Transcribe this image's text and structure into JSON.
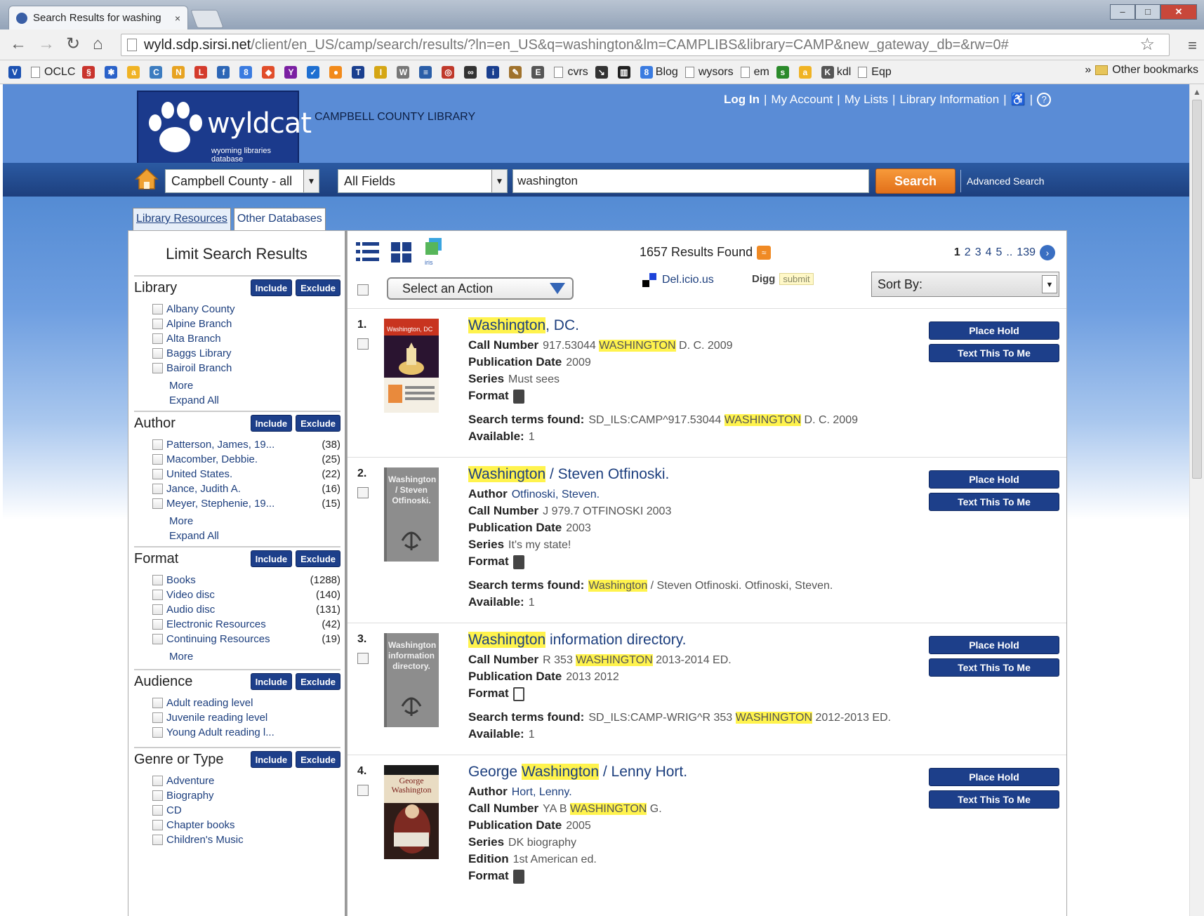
{
  "browser": {
    "tab_title": "Search Results for washing",
    "tab_close": "×",
    "url_host": "wyld.sdp.sirsi.net",
    "url_path": "/client/en_US/camp/search/results/?ln=en_US&q=washington&lm=CAMPLIBS&library=CAMP&new_gateway_db=&rw=0#",
    "window_min": "–",
    "window_max": "□",
    "window_close": "✕",
    "bookmarks": [
      {
        "label": "",
        "icon": "v-icon",
        "color": "#1c52b2",
        "glyph": "V"
      },
      {
        "label": "OCLC",
        "icon": "page-icon"
      },
      {
        "label": "",
        "icon": "swirl-icon",
        "color": "#c9342d",
        "glyph": "§"
      },
      {
        "label": "",
        "icon": "paw-icon",
        "color": "#2a62c9",
        "glyph": "✱"
      },
      {
        "label": "",
        "icon": "amazon-icon",
        "color": "#f0b324",
        "glyph": "a"
      },
      {
        "label": "",
        "icon": "cbd-icon",
        "color": "#3c7cc0",
        "glyph": "C"
      },
      {
        "label": "",
        "icon": "n-icon",
        "color": "#e7a321",
        "glyph": "N"
      },
      {
        "label": "",
        "icon": "lo-icon",
        "color": "#d43b2c",
        "glyph": "L"
      },
      {
        "label": "",
        "icon": "ff-icon",
        "color": "#2c66b6",
        "glyph": "f"
      },
      {
        "label": "",
        "icon": "8-icon",
        "color": "#3a7be0",
        "glyph": "8"
      },
      {
        "label": "",
        "icon": "cube-icon",
        "color": "#e14d2a",
        "glyph": "◆"
      },
      {
        "label": "",
        "icon": "yahoo-icon",
        "color": "#7a1fa2",
        "glyph": "Y"
      },
      {
        "label": "",
        "icon": "check-icon",
        "color": "#1e6fd1",
        "glyph": "✓"
      },
      {
        "label": "",
        "icon": "sun-icon",
        "color": "#f28a1a",
        "glyph": "●"
      },
      {
        "label": "",
        "icon": "twc-icon",
        "color": "#1a3f8f",
        "glyph": "T"
      },
      {
        "label": "",
        "icon": "imdb-icon",
        "color": "#d5a614",
        "glyph": "I"
      },
      {
        "label": "",
        "icon": "wikipedia-icon",
        "color": "#777",
        "glyph": "W"
      },
      {
        "label": "",
        "icon": "chart-icon",
        "color": "#2a5ea8",
        "glyph": "≡"
      },
      {
        "label": "",
        "icon": "globe-icon",
        "color": "#c0392b",
        "glyph": "◎"
      },
      {
        "label": "",
        "icon": "infinity-icon",
        "color": "#333",
        "glyph": "∞"
      },
      {
        "label": "",
        "icon": "info-icon",
        "color": "#1a3f8f",
        "glyph": "i"
      },
      {
        "label": "",
        "icon": "pen-icon",
        "color": "#a0722c",
        "glyph": "✎"
      },
      {
        "label": "",
        "icon": "e-icon",
        "color": "#555",
        "glyph": "E"
      },
      {
        "label": "cvrs",
        "icon": "page-icon"
      },
      {
        "label": "",
        "icon": "arrow-icon",
        "color": "#333",
        "glyph": "↘"
      },
      {
        "label": "",
        "icon": "barcode-icon",
        "color": "#222",
        "glyph": "▥"
      },
      {
        "label": "Blog",
        "icon": "blog-icon",
        "color": "#3a7be0",
        "glyph": "8"
      },
      {
        "label": "wysors",
        "icon": "page-icon"
      },
      {
        "label": "em",
        "icon": "page-icon"
      },
      {
        "label": "",
        "icon": "sf-icon",
        "color": "#2a8a2a",
        "glyph": "s"
      },
      {
        "label": "",
        "icon": "amazon2-icon",
        "color": "#f0b324",
        "glyph": "a"
      },
      {
        "label": "kdl",
        "icon": "kdl-icon",
        "color": "#555",
        "glyph": "K"
      },
      {
        "label": "Eqp",
        "icon": "page-icon"
      }
    ],
    "overflow": "»",
    "other_bookmarks": "Other bookmarks"
  },
  "site": {
    "logo_word": "wyldcat",
    "logo_sub": "wyoming libraries database",
    "library_name": "CAMPBELL COUNTY LIBRARY",
    "links": [
      "Log In",
      "My Account",
      "My Lists",
      "Library Information"
    ],
    "accessibility_glyph": "♿",
    "help_glyph": "?"
  },
  "search": {
    "library_select": "Campbell County - all",
    "field_select": "All Fields",
    "query": "washington",
    "button": "Search",
    "advanced": "Advanced Search"
  },
  "tabs": [
    "Library Resources",
    "Other Databases"
  ],
  "sidebar": {
    "title": "Limit Search Results",
    "include": "Include",
    "exclude": "Exclude",
    "facets": [
      {
        "name": "Library",
        "items": [
          {
            "label": "Albany County",
            "count": ""
          },
          {
            "label": "Alpine Branch",
            "count": ""
          },
          {
            "label": "Alta Branch",
            "count": ""
          },
          {
            "label": "Baggs Library",
            "count": ""
          },
          {
            "label": "Bairoil Branch",
            "count": ""
          }
        ],
        "links": [
          "More",
          "Expand All"
        ]
      },
      {
        "name": "Author",
        "items": [
          {
            "label": "Patterson, James, 19...",
            "count": "(38)"
          },
          {
            "label": "Macomber, Debbie.",
            "count": "(25)"
          },
          {
            "label": "United States.",
            "count": "(22)"
          },
          {
            "label": "Jance, Judith A.",
            "count": "(16)"
          },
          {
            "label": "Meyer, Stephenie, 19...",
            "count": "(15)"
          }
        ],
        "links": [
          "More",
          "Expand All"
        ]
      },
      {
        "name": "Format",
        "items": [
          {
            "label": "Books",
            "count": "(1288)"
          },
          {
            "label": "Video disc",
            "count": "(140)"
          },
          {
            "label": "Audio disc",
            "count": "(131)"
          },
          {
            "label": "Electronic Resources",
            "count": "(42)"
          },
          {
            "label": "Continuing Resources",
            "count": "(19)"
          }
        ],
        "links": [
          "More"
        ]
      },
      {
        "name": "Audience",
        "items": [
          {
            "label": "Adult reading level",
            "count": ""
          },
          {
            "label": "Juvenile reading level",
            "count": ""
          },
          {
            "label": "Young Adult reading l...",
            "count": ""
          }
        ],
        "links": []
      },
      {
        "name": "Genre or Type",
        "items": [
          {
            "label": "Adventure",
            "count": ""
          },
          {
            "label": "Biography",
            "count": ""
          },
          {
            "label": "CD",
            "count": ""
          },
          {
            "label": "Chapter books",
            "count": ""
          },
          {
            "label": "Children's Music",
            "count": ""
          }
        ],
        "links": []
      }
    ]
  },
  "results_header": {
    "found": "1657 Results Found",
    "pages": [
      "1",
      "2",
      "3",
      "4",
      "5",
      "..",
      "139"
    ],
    "action_select": "Select an Action",
    "delicious": "Del.icio.us",
    "digg": "Digg",
    "digg_submit": "submit",
    "sort_by": "Sort By:",
    "iris_label": "iris"
  },
  "result_buttons": {
    "hold": "Place Hold",
    "text": "Text This To Me"
  },
  "results": [
    {
      "num": "1.",
      "title_hl": "Washington",
      "title_rest": ", DC.",
      "cover_text": "Washington, DC",
      "fields": [
        {
          "label": "Call Number",
          "pre": "917.53044 ",
          "hl": "WASHINGTON",
          "post": " D. C. 2009"
        },
        {
          "label": "Publication Date",
          "pre": "2009",
          "hl": "",
          "post": ""
        },
        {
          "label": "Series",
          "pre": "Must sees",
          "hl": "",
          "post": ""
        },
        {
          "label": "Format",
          "pre": "",
          "hl": "",
          "post": "",
          "icon": "book-icon"
        },
        {
          "label": "Search terms found:",
          "pre": "SD_ILS:CAMP^917.53044 ",
          "hl": "WASHINGTON",
          "post": " D. C. 2009"
        },
        {
          "label": "Available:",
          "pre": "1",
          "hl": "",
          "post": ""
        }
      ]
    },
    {
      "num": "2.",
      "title_hl": "Washington",
      "title_rest": " / Steven Otfinoski.",
      "cover_text": "Washington / Steven Otfinoski.",
      "fields": [
        {
          "label": "Author",
          "pre": "Otfinoski, Steven.",
          "hl": "",
          "post": "",
          "link": true
        },
        {
          "label": "Call Number",
          "pre": "J 979.7 OTFINOSKI 2003",
          "hl": "",
          "post": ""
        },
        {
          "label": "Publication Date",
          "pre": "2003",
          "hl": "",
          "post": ""
        },
        {
          "label": "Series",
          "pre": "It's my state!",
          "hl": "",
          "post": ""
        },
        {
          "label": "Format",
          "pre": "",
          "hl": "",
          "post": "",
          "icon": "book-icon"
        },
        {
          "label": "Search terms found:",
          "pre": "",
          "hl": "Washington",
          "post": " / Steven Otfinoski. Otfinoski, Steven."
        },
        {
          "label": "Available:",
          "pre": "1",
          "hl": "",
          "post": ""
        }
      ]
    },
    {
      "num": "3.",
      "title_hl": "Washington",
      "title_rest": " information directory.",
      "cover_text": "Washington information directory.",
      "fields": [
        {
          "label": "Call Number",
          "pre": "R 353 ",
          "hl": "WASHINGTON",
          "post": " 2013-2014 ED."
        },
        {
          "label": "Publication Date",
          "pre": "2013 2012",
          "hl": "",
          "post": ""
        },
        {
          "label": "Format",
          "pre": "",
          "hl": "",
          "post": "",
          "icon": "form-icon"
        },
        {
          "label": "Search terms found:",
          "pre": "SD_ILS:CAMP-WRIG^R 353 ",
          "hl": "WASHINGTON",
          "post": " 2012-2013 ED."
        },
        {
          "label": "Available:",
          "pre": "1",
          "hl": "",
          "post": ""
        }
      ]
    },
    {
      "num": "4.",
      "title_pre": "George ",
      "title_hl": "Washington",
      "title_rest": " / Lenny Hort.",
      "cover_text": "George Washington",
      "fields": [
        {
          "label": "Author",
          "pre": "Hort, Lenny.",
          "hl": "",
          "post": "",
          "link": true
        },
        {
          "label": "Call Number",
          "pre": "YA B ",
          "hl": "WASHINGTON",
          "post": " G."
        },
        {
          "label": "Publication Date",
          "pre": "2005",
          "hl": "",
          "post": ""
        },
        {
          "label": "Series",
          "pre": "DK biography",
          "hl": "",
          "post": ""
        },
        {
          "label": "Edition",
          "pre": "1st American ed.",
          "hl": "",
          "post": ""
        },
        {
          "label": "Format",
          "pre": "",
          "hl": "",
          "post": "",
          "icon": "book-icon"
        }
      ]
    }
  ]
}
